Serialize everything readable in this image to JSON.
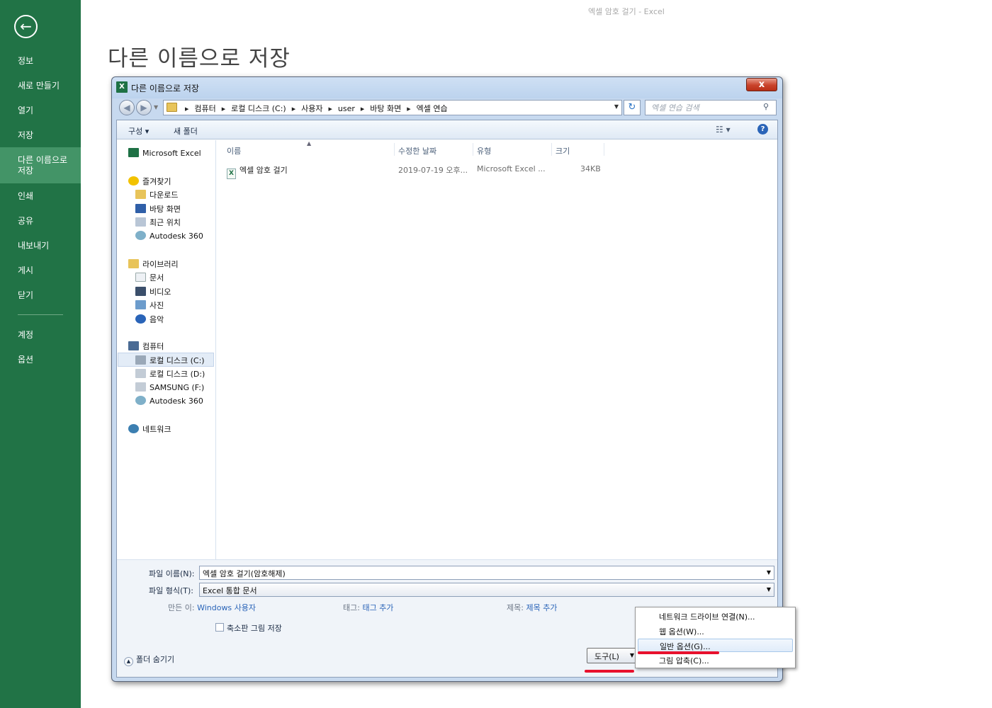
{
  "window_title": "엑셀 암호 걸기 - Excel",
  "page_title": "다른 이름으로 저장",
  "backstage": {
    "items": [
      {
        "label": "정보"
      },
      {
        "label": "새로 만들기"
      },
      {
        "label": "열기"
      },
      {
        "label": "저장"
      },
      {
        "label": "다른 이름으로\n저장"
      },
      {
        "label": "인쇄"
      },
      {
        "label": "공유"
      },
      {
        "label": "내보내기"
      },
      {
        "label": "게시"
      },
      {
        "label": "닫기"
      },
      {
        "label": "계정"
      },
      {
        "label": "옵션"
      }
    ],
    "active_index": 4
  },
  "dialog": {
    "title": "다른 이름으로 저장",
    "close_label": "x",
    "breadcrumbs": [
      "컴퓨터",
      "로컬 디스크 (C:)",
      "사용자",
      "user",
      "바탕 화면",
      "엑셀 연습"
    ],
    "search_placeholder": "엑셀 연습 검색",
    "toolbar": {
      "organize": "구성 ▾",
      "new_folder": "새 폴더"
    },
    "nav": {
      "excel": "Microsoft Excel",
      "favorites": "즐겨찾기",
      "favorites_items": [
        "다운로드",
        "바탕 화면",
        "최근 위치",
        "Autodesk 360"
      ],
      "libraries": "라이브러리",
      "libraries_items": [
        "문서",
        "비디오",
        "사진",
        "음악"
      ],
      "computer": "컴퓨터",
      "computer_items": [
        "로컬 디스크 (C:)",
        "로컬 디스크 (D:)",
        "SAMSUNG (F:)",
        "Autodesk 360"
      ],
      "network": "네트워크"
    },
    "columns": [
      "이름",
      "수정한 날짜",
      "유형",
      "크기"
    ],
    "files": [
      {
        "name": "엑셀 암호 걸기",
        "modified": "2019-07-19 오후...",
        "type": "Microsoft Excel ...",
        "size": "34KB"
      }
    ],
    "filename_label": "파일 이름(N):",
    "filename_value": "엑셀 암호 걸기(암호해제)",
    "filetype_label": "파일 형식(T):",
    "filetype_value": "Excel 통합 문서",
    "authors_label": "만든 이:",
    "authors_value": "Windows 사용자",
    "tags_label": "태그:",
    "tags_value": "태그 추가",
    "title_label": "제목:",
    "title_value": "제목 추가",
    "thumbnail_label": "축소판 그림 저장",
    "hide_folders": "폴더 숨기기",
    "tools_label": "도구(L)"
  },
  "tools_menu": {
    "items": [
      "네트워크 드라이브 연결(N)...",
      "웹 옵션(W)...",
      "일반 옵션(G)...",
      "그림 압축(C)..."
    ],
    "highlighted_index": 2
  },
  "colors": {
    "backstage": "#217346",
    "highlight": "#e8112d"
  }
}
